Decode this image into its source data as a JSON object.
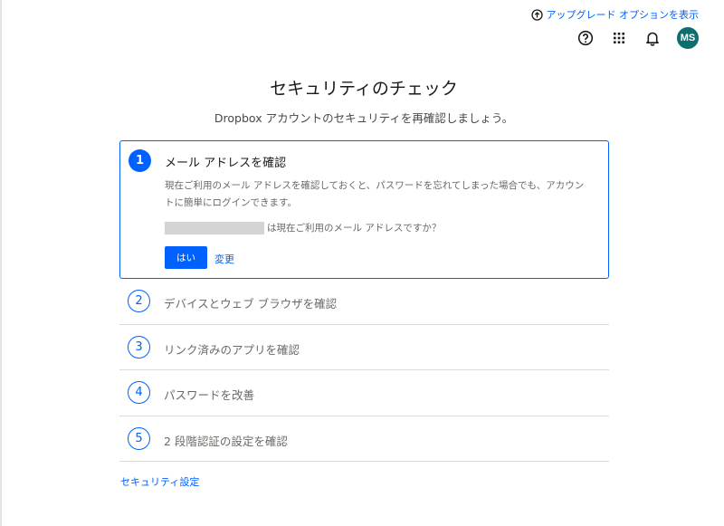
{
  "header": {
    "upgrade_link": "アップグレード オプションを表示",
    "icons": [
      "upgrade-arrow-icon",
      "help-icon",
      "app-grid-icon",
      "notification-bell-icon"
    ],
    "avatar_initials": "MS",
    "avatar_color": "#0e6e6e"
  },
  "main": {
    "title": "セキュリティのチェック",
    "subtitle": "Dropbox アカウントのセキュリティを再確認しましょう。",
    "accent_color": "#0061fe"
  },
  "active_step": {
    "number": "1",
    "title": "メール アドレスを確認",
    "description": "現在ご利用のメール アドレスを確認しておくと、パスワードを忘れてしまった場合でも、アカウントに簡単にログインできます。",
    "question": "は現在ご利用のメール アドレスですか？",
    "yes_button": "はい",
    "change_link": "変更"
  },
  "steps": [
    {
      "number": "2",
      "label": "デバイスとウェブ ブラウザを確認"
    },
    {
      "number": "3",
      "label": "リンク済みのアプリを確認"
    },
    {
      "number": "4",
      "label": "パスワードを改善"
    },
    {
      "number": "5",
      "label": "2 段階認証の設定を確認"
    }
  ],
  "footer": {
    "security_settings_link": "セキュリティ設定"
  }
}
